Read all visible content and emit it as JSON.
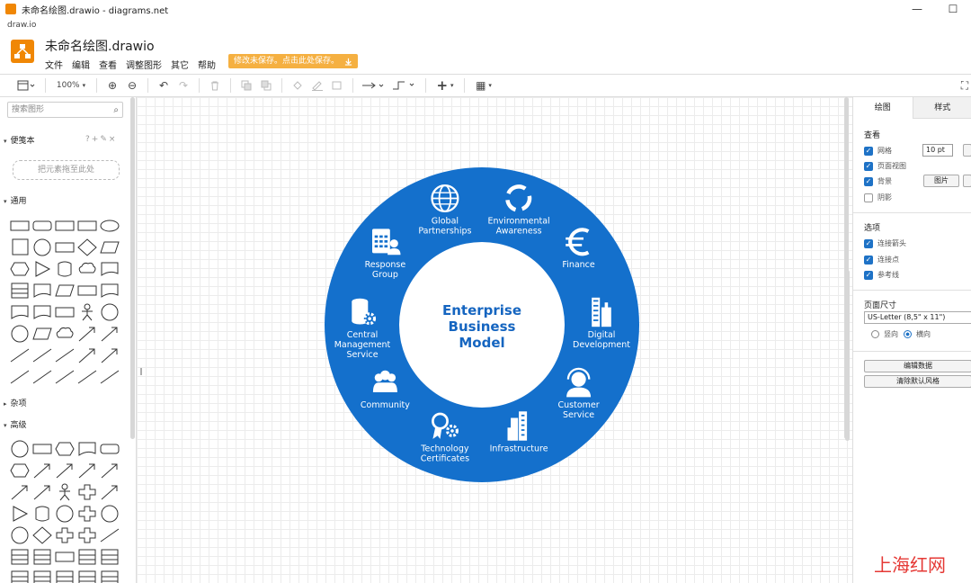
{
  "window": {
    "title": "未命名绘图.drawio - diagrams.net",
    "minimize": "—",
    "maximize": "☐",
    "url": "draw.io"
  },
  "header": {
    "doc_title": "未命名绘图.drawio",
    "menu": [
      "文件",
      "编辑",
      "查看",
      "调整图形",
      "其它",
      "帮助"
    ],
    "unsaved_notice": "修改未保存。点击此处保存。"
  },
  "toolbar": {
    "zoom": "100%",
    "zoom_in": "⊕",
    "zoom_out": "⊖",
    "undo": "↶",
    "redo": "↷",
    "delete": "🗑",
    "plus": "+",
    "grid": "▦",
    "fullscreen": "⛶"
  },
  "sidebar": {
    "search_placeholder": "搜索图形",
    "scratchpad": "便笺本",
    "scratch_controls": "?+✎×",
    "dropzone": "把元素拖至此处",
    "general": "通用",
    "misc": "杂项",
    "advanced": "高级"
  },
  "diagram": {
    "center": [
      "Enterprise",
      "Business",
      "Model"
    ],
    "items": [
      {
        "icon": "globe-icon",
        "label": [
          "Global",
          "Partnerships"
        ]
      },
      {
        "icon": "recycle-icon",
        "label": [
          "Environmental",
          "Awareness"
        ]
      },
      {
        "icon": "euro-icon",
        "label": [
          "Finance"
        ]
      },
      {
        "icon": "buildings-icon",
        "label": [
          "Digital",
          "Development"
        ]
      },
      {
        "icon": "headset-icon",
        "label": [
          "Customer",
          "Service"
        ]
      },
      {
        "icon": "skyscraper-icon",
        "label": [
          "Infrastructure"
        ]
      },
      {
        "icon": "award-gear-icon",
        "label": [
          "Technology",
          "Certificates"
        ]
      },
      {
        "icon": "people-icon",
        "label": [
          "Community"
        ]
      },
      {
        "icon": "database-gear-icon",
        "label": [
          "Central",
          "Management",
          "Service"
        ]
      },
      {
        "icon": "fax-people-icon",
        "label": [
          "Response",
          "Group"
        ]
      }
    ],
    "ring_color": "#1470cc",
    "text_color": "#ffffff",
    "center_text_color": "#1565c0"
  },
  "rpanel": {
    "tab_diagram": "绘图",
    "tab_style": "样式",
    "view_label": "查看",
    "grid": "网格",
    "grid_size": "10 pt",
    "page_view": "页面视图",
    "background": "背景",
    "image_button": "图片",
    "shadow": "阴影",
    "options_label": "选项",
    "connection_arrows": "连接箭头",
    "connection_points": "连接点",
    "guides": "参考线",
    "page_size_label": "页面尺寸",
    "page_size": "US-Letter (8,5\" x 11\")",
    "portrait": "竖向",
    "landscape": "横向",
    "edit_data": "编辑数据",
    "clear_style": "清除默认风格"
  },
  "watermark": "上海红网"
}
